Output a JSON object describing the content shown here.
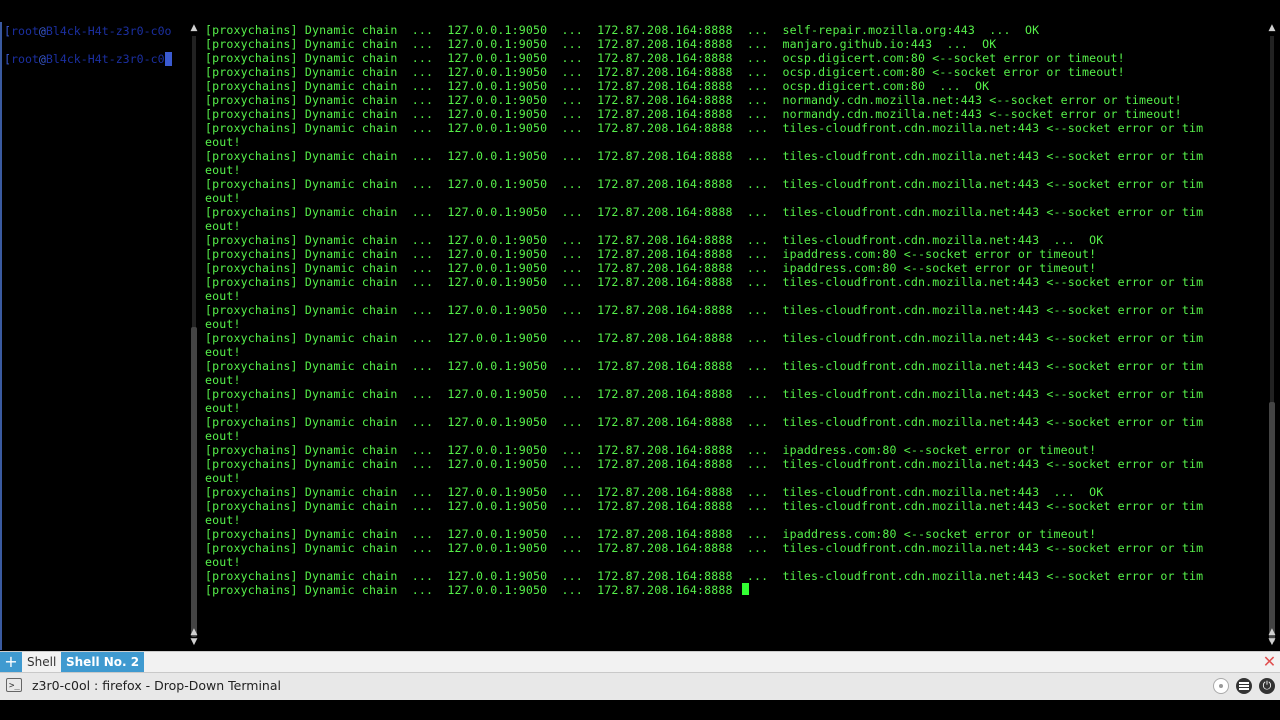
{
  "left_pane": {
    "lines": [
      {
        "open": "[",
        "user": "root",
        "at": "@",
        "host": "Bl4ck-H4t-z3r0-c0o"
      },
      {
        "open": "[",
        "user": "root",
        "at": "@",
        "host": "Bl4ck-H4t-z3r0-c0"
      }
    ]
  },
  "terminal": {
    "lines": [
      "[proxychains] Dynamic chain  ...  127.0.0.1:9050  ...  172.87.208.164:8888  ...  self-repair.mozilla.org:443  ...  OK",
      "[proxychains] Dynamic chain  ...  127.0.0.1:9050  ...  172.87.208.164:8888  ...  manjaro.github.io:443  ...  OK",
      "[proxychains] Dynamic chain  ...  127.0.0.1:9050  ...  172.87.208.164:8888  ...  ocsp.digicert.com:80 <--socket error or timeout!",
      "[proxychains] Dynamic chain  ...  127.0.0.1:9050  ...  172.87.208.164:8888  ...  ocsp.digicert.com:80 <--socket error or timeout!",
      "[proxychains] Dynamic chain  ...  127.0.0.1:9050  ...  172.87.208.164:8888  ...  ocsp.digicert.com:80  ...  OK",
      "[proxychains] Dynamic chain  ...  127.0.0.1:9050  ...  172.87.208.164:8888  ...  normandy.cdn.mozilla.net:443 <--socket error or timeout!",
      "[proxychains] Dynamic chain  ...  127.0.0.1:9050  ...  172.87.208.164:8888  ...  normandy.cdn.mozilla.net:443 <--socket error or timeout!",
      "[proxychains] Dynamic chain  ...  127.0.0.1:9050  ...  172.87.208.164:8888  ...  tiles-cloudfront.cdn.mozilla.net:443 <--socket error or tim",
      "eout!",
      "[proxychains] Dynamic chain  ...  127.0.0.1:9050  ...  172.87.208.164:8888  ...  tiles-cloudfront.cdn.mozilla.net:443 <--socket error or tim",
      "eout!",
      "[proxychains] Dynamic chain  ...  127.0.0.1:9050  ...  172.87.208.164:8888  ...  tiles-cloudfront.cdn.mozilla.net:443 <--socket error or tim",
      "eout!",
      "[proxychains] Dynamic chain  ...  127.0.0.1:9050  ...  172.87.208.164:8888  ...  tiles-cloudfront.cdn.mozilla.net:443 <--socket error or tim",
      "eout!",
      "[proxychains] Dynamic chain  ...  127.0.0.1:9050  ...  172.87.208.164:8888  ...  tiles-cloudfront.cdn.mozilla.net:443  ...  OK",
      "[proxychains] Dynamic chain  ...  127.0.0.1:9050  ...  172.87.208.164:8888  ...  ipaddress.com:80 <--socket error or timeout!",
      "[proxychains] Dynamic chain  ...  127.0.0.1:9050  ...  172.87.208.164:8888  ...  ipaddress.com:80 <--socket error or timeout!",
      "[proxychains] Dynamic chain  ...  127.0.0.1:9050  ...  172.87.208.164:8888  ...  tiles-cloudfront.cdn.mozilla.net:443 <--socket error or tim",
      "eout!",
      "[proxychains] Dynamic chain  ...  127.0.0.1:9050  ...  172.87.208.164:8888  ...  tiles-cloudfront.cdn.mozilla.net:443 <--socket error or tim",
      "eout!",
      "[proxychains] Dynamic chain  ...  127.0.0.1:9050  ...  172.87.208.164:8888  ...  tiles-cloudfront.cdn.mozilla.net:443 <--socket error or tim",
      "eout!",
      "[proxychains] Dynamic chain  ...  127.0.0.1:9050  ...  172.87.208.164:8888  ...  tiles-cloudfront.cdn.mozilla.net:443 <--socket error or tim",
      "eout!",
      "[proxychains] Dynamic chain  ...  127.0.0.1:9050  ...  172.87.208.164:8888  ...  tiles-cloudfront.cdn.mozilla.net:443 <--socket error or tim",
      "eout!",
      "[proxychains] Dynamic chain  ...  127.0.0.1:9050  ...  172.87.208.164:8888  ...  tiles-cloudfront.cdn.mozilla.net:443 <--socket error or tim",
      "eout!",
      "[proxychains] Dynamic chain  ...  127.0.0.1:9050  ...  172.87.208.164:8888  ...  ipaddress.com:80 <--socket error or timeout!",
      "[proxychains] Dynamic chain  ...  127.0.0.1:9050  ...  172.87.208.164:8888  ...  tiles-cloudfront.cdn.mozilla.net:443 <--socket error or tim",
      "eout!",
      "[proxychains] Dynamic chain  ...  127.0.0.1:9050  ...  172.87.208.164:8888  ...  tiles-cloudfront.cdn.mozilla.net:443  ...  OK",
      "[proxychains] Dynamic chain  ...  127.0.0.1:9050  ...  172.87.208.164:8888  ...  tiles-cloudfront.cdn.mozilla.net:443 <--socket error or tim",
      "eout!",
      "[proxychains] Dynamic chain  ...  127.0.0.1:9050  ...  172.87.208.164:8888  ...  ipaddress.com:80 <--socket error or timeout!",
      "[proxychains] Dynamic chain  ...  127.0.0.1:9050  ...  172.87.208.164:8888  ...  tiles-cloudfront.cdn.mozilla.net:443 <--socket error or tim",
      "eout!",
      "[proxychains] Dynamic chain  ...  127.0.0.1:9050  ...  172.87.208.164:8888  ...  tiles-cloudfront.cdn.mozilla.net:443 <--socket error or tim"
    ],
    "prompt_line": "[proxychains] Dynamic chain  ...  127.0.0.1:9050  ...  172.87.208.164:8888 ",
    "text_color": "#56f04a",
    "cursor_color": "#33ff33"
  },
  "tabs": {
    "new_tab_icon": "plus-icon",
    "items": [
      {
        "label": "Shell",
        "active": false
      },
      {
        "label": "Shell No. 2",
        "active": true
      }
    ],
    "close_icon": "close-icon",
    "accent": "#3f9ad0"
  },
  "statusbar": {
    "icon": "terminal-icon",
    "title": "z3r0-c0ol : firefox - Drop-Down Terminal",
    "quit_glyph": "⏻"
  }
}
